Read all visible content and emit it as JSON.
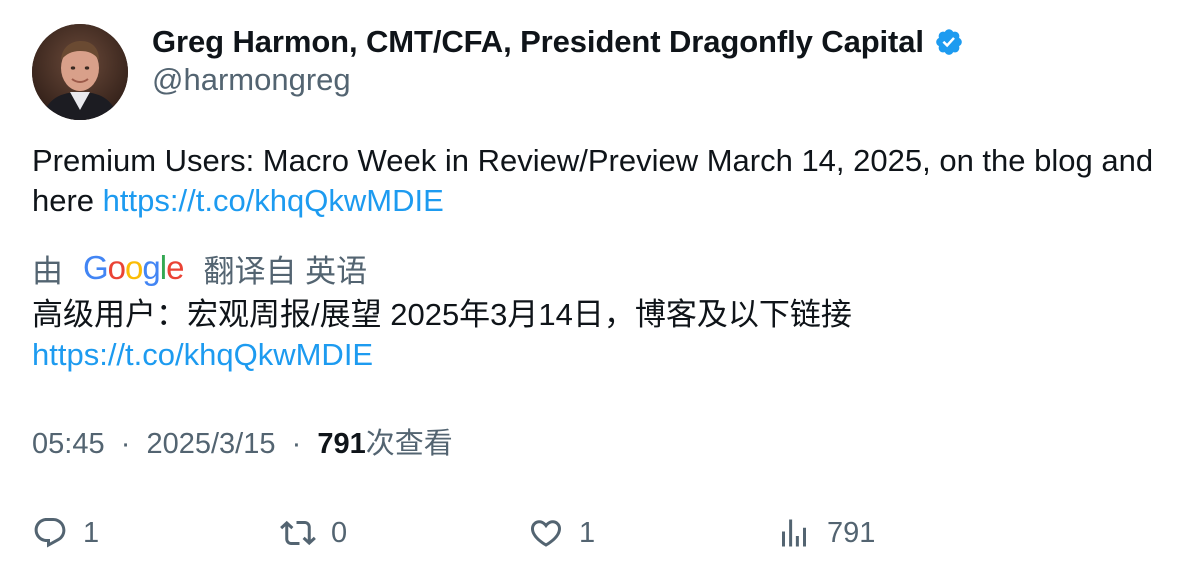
{
  "author": {
    "display_name": "Greg Harmon, CMT/CFA, President Dragonfly Capital",
    "handle": "@harmongreg",
    "verified": true,
    "verified_color": "#1d9bf0"
  },
  "tweet": {
    "text_before_link": "Premium Users: Macro Week in Review/Preview March 14, 2025, on the blog and here ",
    "link": "https://t.co/khqQkwMDIE"
  },
  "translation": {
    "prefix": "由",
    "provider": "Google",
    "suffix": "翻译自 英语",
    "text": "高级用户：宏观周报/展望 2025年3月14日，博客及以下链接",
    "link": "https://t.co/khqQkwMDIE"
  },
  "meta": {
    "time": "05:45",
    "separator": "·",
    "date": "2025/3/15",
    "views_count": "791",
    "views_label": "次查看"
  },
  "actions": {
    "reply": {
      "icon": "reply-icon",
      "count": "1"
    },
    "retweet": {
      "icon": "retweet-icon",
      "count": "0"
    },
    "like": {
      "icon": "heart-icon",
      "count": "1"
    },
    "views": {
      "icon": "analytics-icon",
      "count": "791"
    }
  },
  "colors": {
    "text": "#0f1419",
    "secondary": "#536471",
    "link": "#1d9bf0"
  }
}
